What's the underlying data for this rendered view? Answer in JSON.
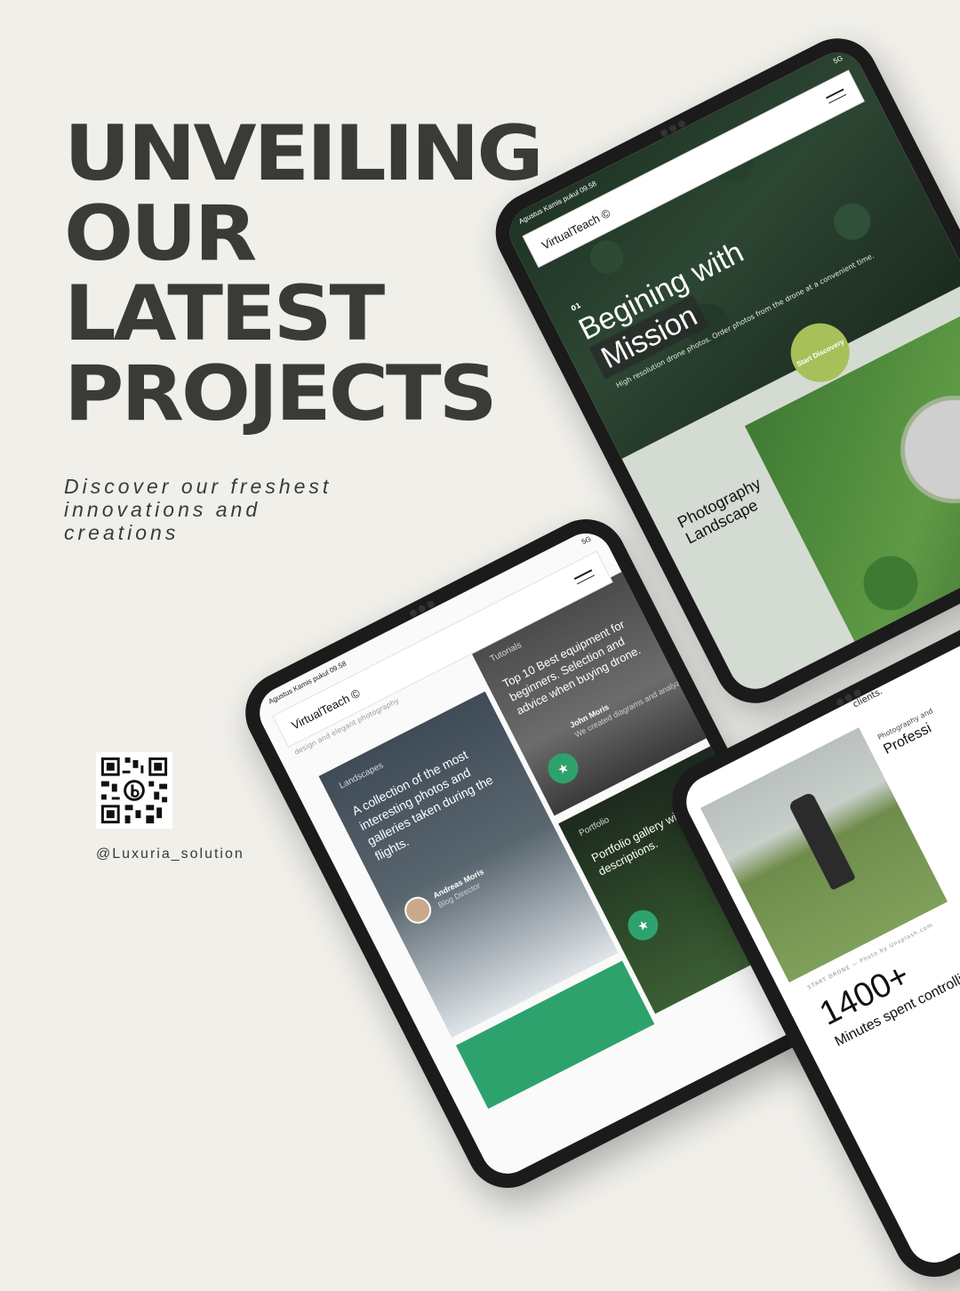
{
  "headline": {
    "lines": [
      "UNVEILING",
      "OUR",
      "LATEST",
      "PROJECTS"
    ]
  },
  "subline": {
    "lines": [
      "Discover our freshest",
      "innovations and",
      "creations"
    ]
  },
  "social": {
    "handle": "@Luxuria_solution"
  },
  "tablet_forest": {
    "status_left": "Agustus Kamis pukul 09.58",
    "status_right": "5G",
    "brand": "VirtualTeach ©",
    "section_number": "01",
    "title_lines": [
      "Begining with",
      "Mission"
    ],
    "subtitle": "High resolution drone photos. Order photos from the drone at a convenient time.",
    "cta": "Start Discovery",
    "section_title_lines": [
      "Photography",
      "Landscape"
    ]
  },
  "tablet_blog": {
    "status_left": "Agustus Kamis pukul 09.58",
    "status_right": "5G",
    "brand": "VirtualTeach ©",
    "subheading": "design and elegant photography",
    "card_landscapes": {
      "tag": "Landscapes",
      "text": "A collection of the most interesting photos and galleries taken during the flights.",
      "author_name": "Andreas Moris",
      "author_role": "Blog Director"
    },
    "card_tutorials": {
      "tag": "Tutorials",
      "text": "Top 10 Best equipment for beginners. Selection and advice when buying drone.",
      "author_name": "John Moris",
      "author_role": "We created diagrams and analyzes"
    },
    "card_portfolio": {
      "tag": "Portfolio",
      "text": "Portfolio gallery with detailed descriptions."
    }
  },
  "tablet_drone": {
    "clients_label": "clients.",
    "category": "Photography and",
    "heading": "Professi",
    "caption": "START DRONE — Photo by Unsplash.com",
    "stat_number": "1400+",
    "stat_text": "Minutes spent controlling the drone in the air."
  }
}
